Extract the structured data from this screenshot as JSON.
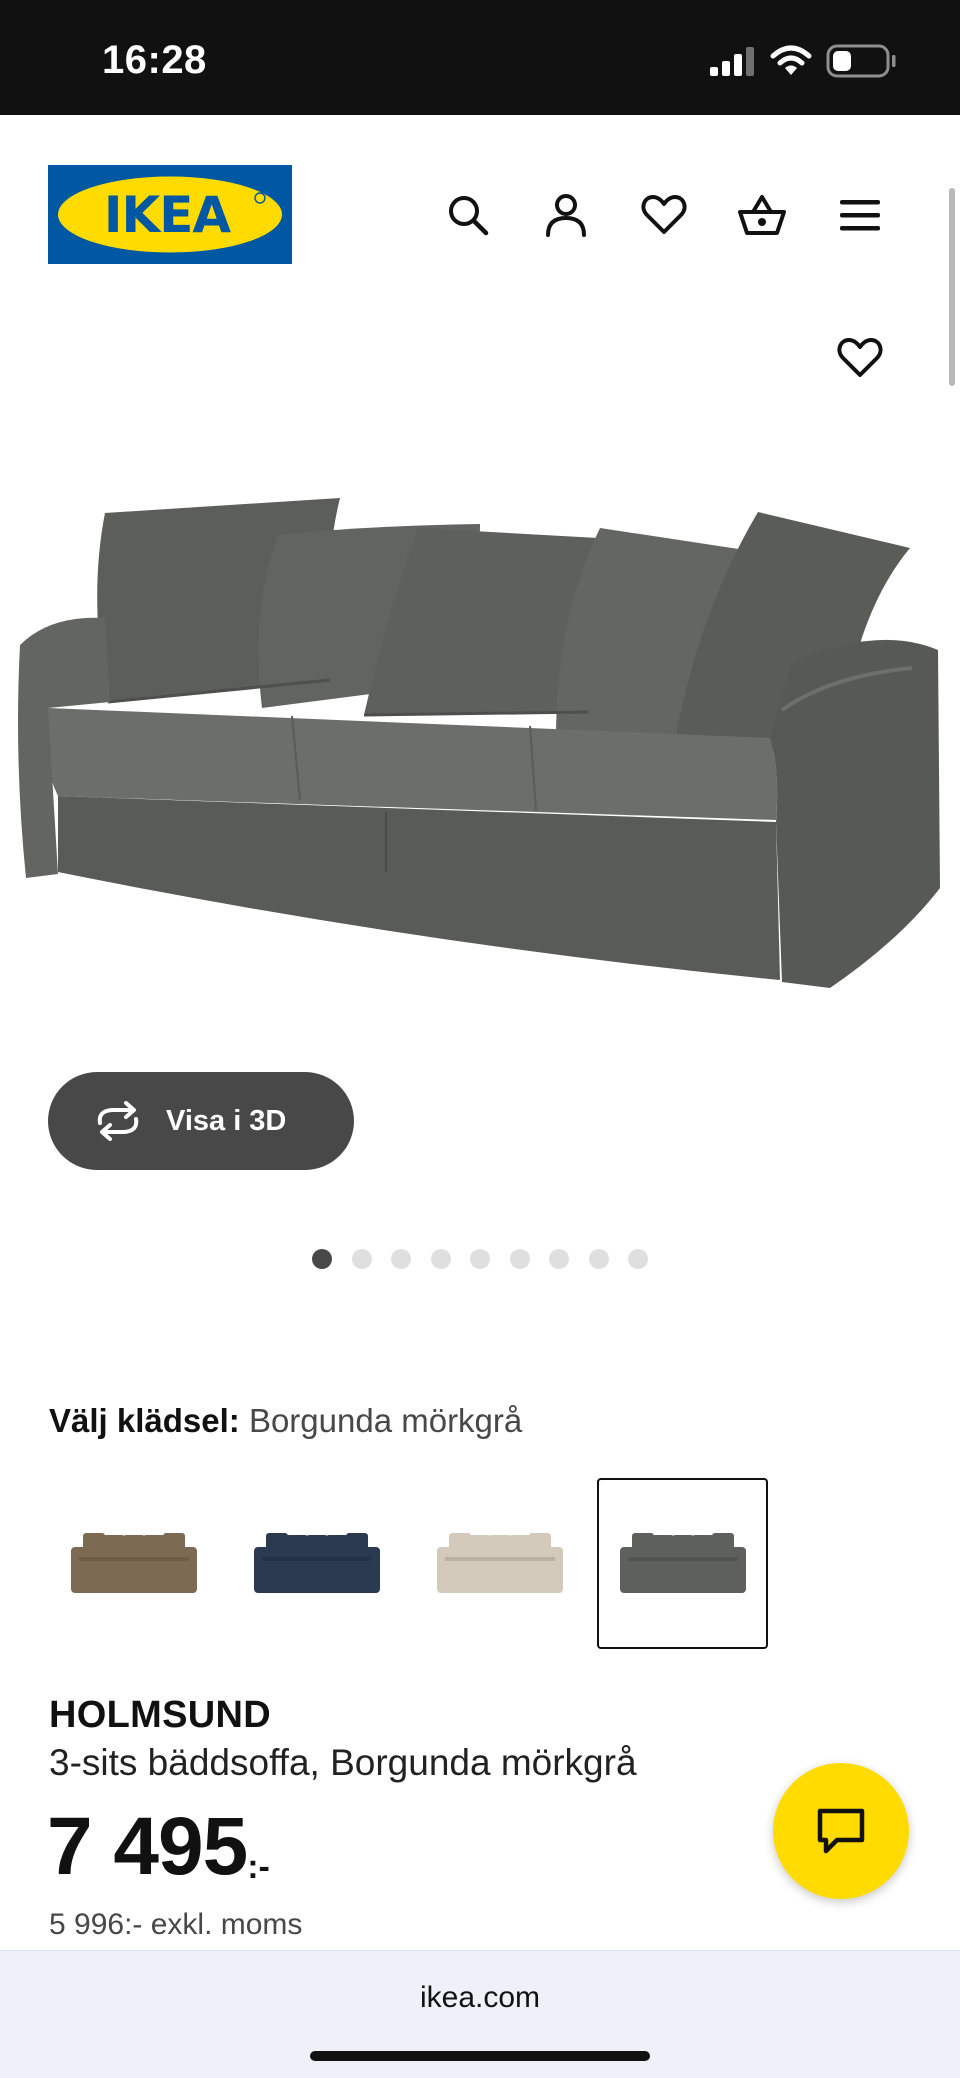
{
  "status_bar": {
    "time": "16:28",
    "battery_level": 0.35
  },
  "header": {
    "logo_text": "IKEA",
    "icons": [
      "search-icon",
      "account-icon",
      "heart-icon",
      "basket-icon",
      "menu-icon"
    ]
  },
  "colors": {
    "brand_blue": "#0058a3",
    "brand_yellow": "#ffdb00",
    "sofa_gray": "#5e605b",
    "button_dark": "#484848"
  },
  "gallery": {
    "view_3d_label": "Visa i 3D",
    "image_count": 9,
    "active_index": 0
  },
  "variant": {
    "label": "Välj klädsel:",
    "selected_value": "Borgunda mörkgrå",
    "swatch_colors": [
      "#7d6a52",
      "#2b3a50",
      "#d3cabb",
      "#5e605b"
    ],
    "selected_index": 3
  },
  "product": {
    "name": "HOLMSUND",
    "description": "3-sits bäddsoffa, Borgunda mörkgrå",
    "price": "7 495",
    "price_suffix": ":-",
    "price_ex_vat": "5 996:- exkl. moms"
  },
  "browser": {
    "url": "ikea.com"
  }
}
